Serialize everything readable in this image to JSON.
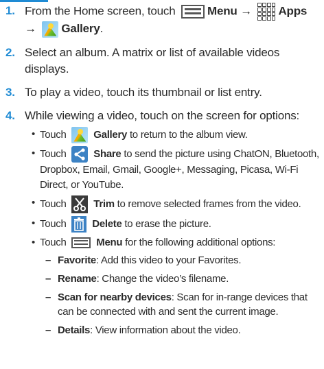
{
  "colors": {
    "accent": "#1f8bd4",
    "text": "#2b2b2b",
    "share_icon_bg": "#3c82c4"
  },
  "steps": [
    {
      "number": "1.",
      "parts": [
        "From the Home screen, touch",
        "Menu",
        "→",
        "Apps",
        "→",
        "Gallery",
        "."
      ]
    },
    {
      "number": "2.",
      "text": "Select an album. A matrix or list of available videos displays."
    },
    {
      "number": "3.",
      "text": "To play a video, touch its thumbnail or list entry."
    },
    {
      "number": "4.",
      "text": "While viewing a video, touch on the screen for options:",
      "bullets": [
        {
          "touch": "Touch",
          "label": "Gallery",
          "icon": "gallery-icon",
          "text": "to return to the album view."
        },
        {
          "touch": "Touch",
          "label": "Share",
          "icon": "share-icon",
          "text": "to send the picture using ChatON, Bluetooth, Dropbox, Email, Gmail, Google+, Messaging, Picasa, Wi-Fi Direct, or YouTube."
        },
        {
          "touch": "Touch",
          "label": "Trim",
          "icon": "scissors-icon",
          "text": "to remove selected frames from the video."
        },
        {
          "touch": "Touch",
          "label": "Delete",
          "icon": "trash-icon",
          "text": "to erase the picture."
        },
        {
          "touch": "Touch",
          "label": "Menu",
          "icon": "menu-icon",
          "text": "for the following additional options:"
        }
      ],
      "menu_options": [
        {
          "label": "Favorite",
          "text": ": Add this video to your Favorites."
        },
        {
          "label": "Rename",
          "text": ": Change the video’s filename."
        },
        {
          "label": "Scan for nearby devices",
          "text": ": Scan for in-range devices that can be connected with and sent the current image."
        },
        {
          "label": "Details",
          "text": ": View information about the video."
        }
      ]
    }
  ]
}
